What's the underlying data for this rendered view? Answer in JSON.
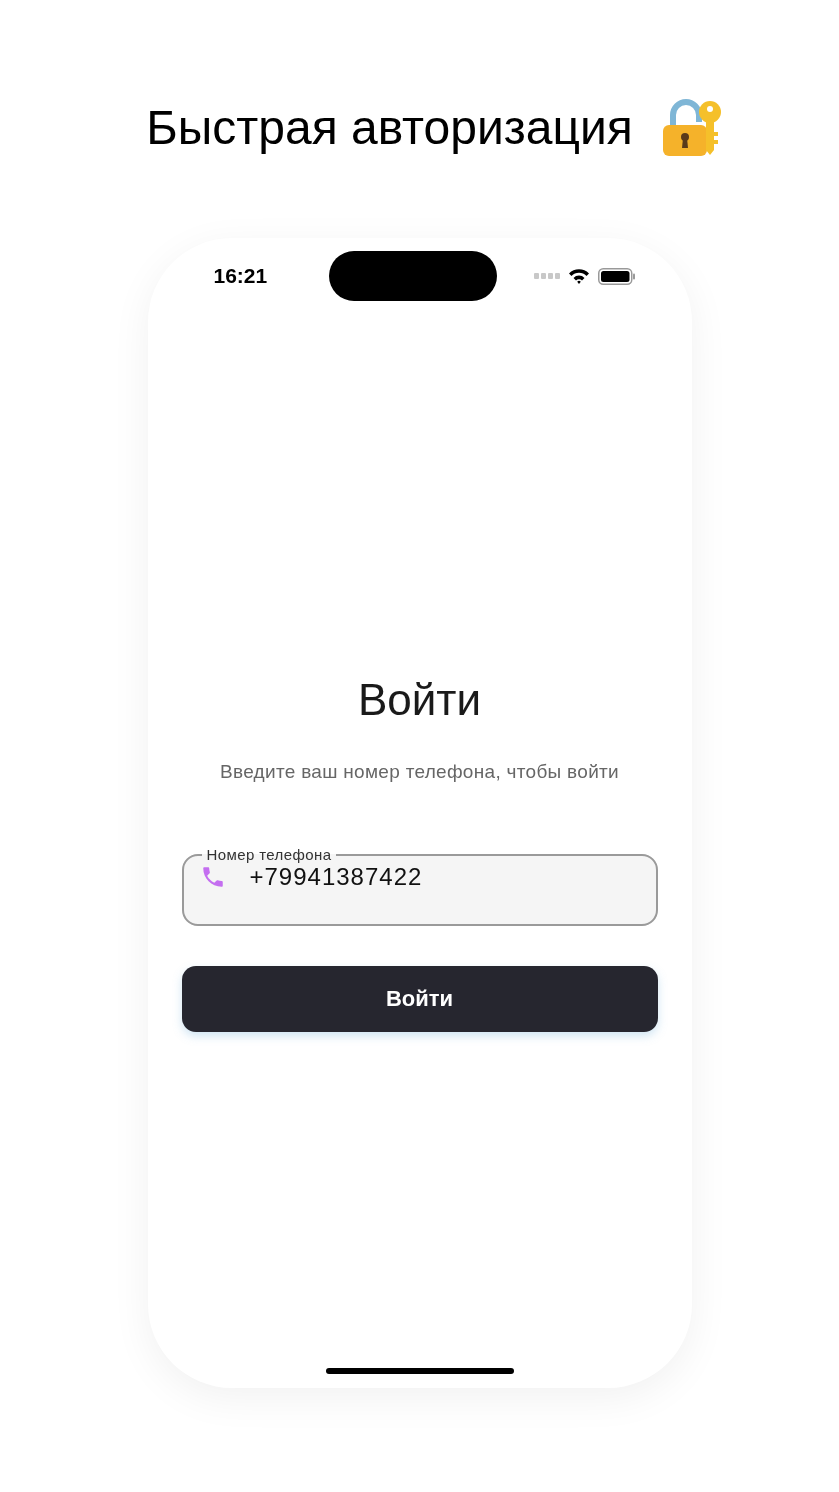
{
  "header": {
    "title": "Быстрая авторизация"
  },
  "status_bar": {
    "time": "16:21"
  },
  "login": {
    "title": "Войти",
    "subtitle": "Введите ваш номер телефона, чтобы войти",
    "phone_field": {
      "label": "Номер телефона",
      "value": "+79941387422"
    },
    "submit_button": "Войти"
  }
}
